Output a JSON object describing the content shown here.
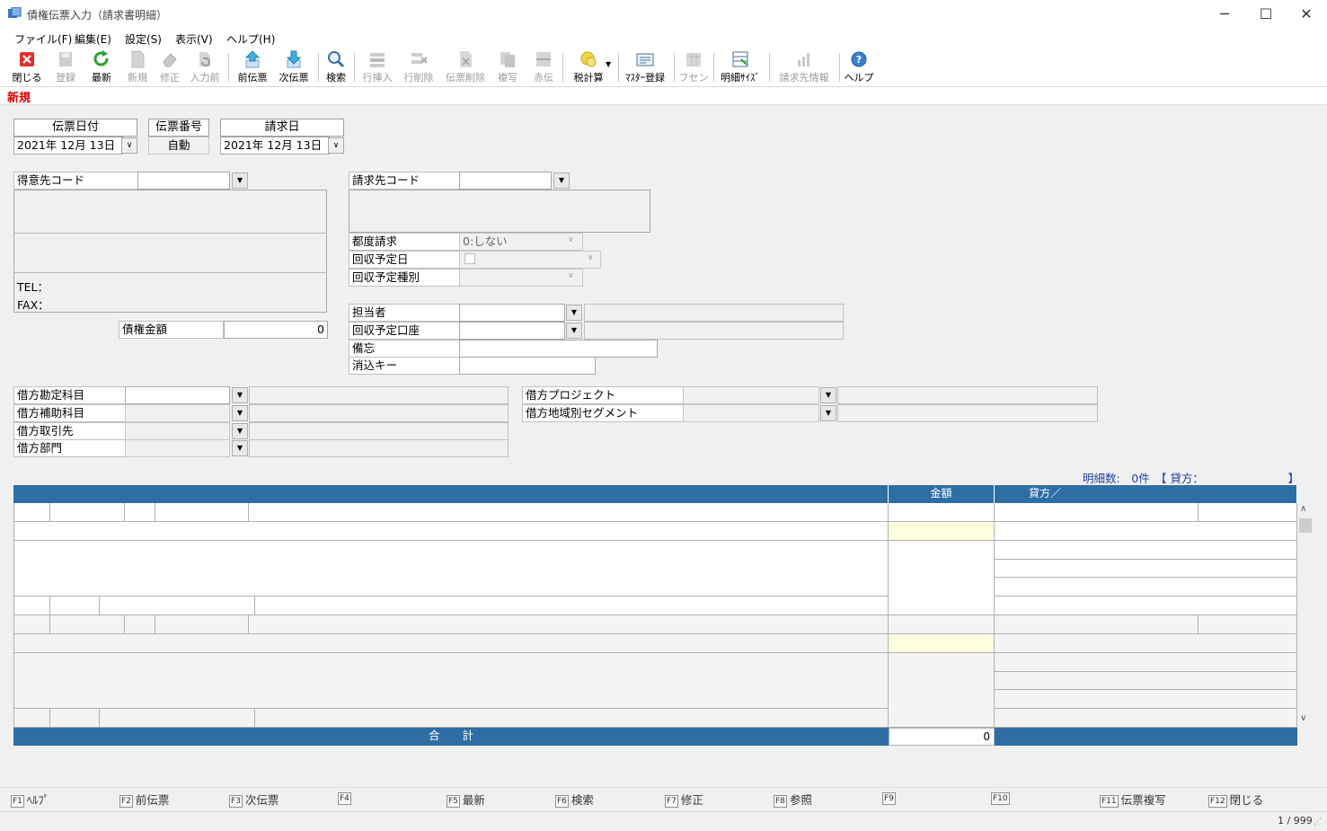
{
  "window": {
    "title": "債権伝票入力（請求書明細）",
    "minimize": "─",
    "maximize": "☐",
    "close": "✕"
  },
  "menu": [
    "ファイル(F)",
    "編集(E)",
    "設定(S)",
    "表示(V)",
    "ヘルプ(H)"
  ],
  "toolbar": [
    {
      "label": "閉じる",
      "icon": "close-icon",
      "enabled": true
    },
    {
      "label": "登録",
      "icon": "save-icon",
      "enabled": false
    },
    {
      "label": "最新",
      "icon": "refresh-icon",
      "enabled": true
    },
    {
      "label": "新規",
      "icon": "new-doc-icon",
      "enabled": false
    },
    {
      "label": "修正",
      "icon": "eraser-icon",
      "enabled": false
    },
    {
      "label": "入力前",
      "icon": "undo-icon",
      "enabled": false
    },
    {
      "label": "前伝票",
      "icon": "prev-arrow-icon",
      "enabled": true
    },
    {
      "label": "次伝票",
      "icon": "next-arrow-icon",
      "enabled": true
    },
    {
      "label": "検索",
      "icon": "search-icon",
      "enabled": true
    },
    {
      "label": "行挿入",
      "icon": "insert-row-icon",
      "enabled": false
    },
    {
      "label": "行削除",
      "icon": "delete-row-icon",
      "enabled": false
    },
    {
      "label": "伝票削除",
      "icon": "delete-doc-icon",
      "enabled": false
    },
    {
      "label": "複写",
      "icon": "copy-icon",
      "enabled": false
    },
    {
      "label": "赤伝",
      "icon": "red-slip-icon",
      "enabled": false
    },
    {
      "label": "税計算",
      "icon": "tax-calc-icon",
      "enabled": true
    },
    {
      "label": "ﾏｽﾀｰ登録",
      "icon": "master-register-icon",
      "enabled": true
    },
    {
      "label": "フセン",
      "icon": "sticky-note-icon",
      "enabled": false
    },
    {
      "label": "明細ｻｲｽﾞ",
      "icon": "detail-size-icon",
      "enabled": true
    },
    {
      "label": "請求先情報",
      "icon": "bar-chart-icon",
      "enabled": false
    },
    {
      "label": "ヘルプ",
      "icon": "help-icon",
      "enabled": true
    }
  ],
  "mode": "新規",
  "header": {
    "slip_date_label": "伝票日付",
    "slip_date_value": "2021年 12月 13日",
    "slip_no_label": "伝票番号",
    "slip_no_value": "自動",
    "billing_date_label": "請求日",
    "billing_date_value": "2021年 12月 13日"
  },
  "customer": {
    "code_label": "得意先コード",
    "tel_label": "TEL：",
    "fax_label": "FAX：",
    "amount_label": "債権金額",
    "amount_value": "0"
  },
  "billing": {
    "code_label": "請求先コード",
    "each_billing_label": "都度請求",
    "each_billing_value": "0:しない",
    "collect_date_label": "回収予定日",
    "collect_type_label": "回収予定種別",
    "staff_label": "担当者",
    "collect_account_label": "回収予定口座",
    "memo_label": "備忘",
    "clear_key_label": "消込キー"
  },
  "debit": {
    "account_label": "借方勘定科目",
    "sub_account_label": "借方補助科目",
    "partner_label": "借方取引先",
    "dept_label": "借方部門",
    "project_label": "借方プロジェクト",
    "segment_label": "借方地域別セグメント"
  },
  "summary": {
    "detail_count": "明細数:　0件　【 貸方：　　　　　　　　】"
  },
  "grid": {
    "amount_header": "金額",
    "credit_header": "貸方／",
    "total_label": "合　　計",
    "total_value": "0"
  },
  "fkeys": [
    {
      "key": "F1",
      "label": "ﾍﾙﾌﾟ"
    },
    {
      "key": "F2",
      "label": "前伝票"
    },
    {
      "key": "F3",
      "label": "次伝票"
    },
    {
      "key": "F4",
      "label": ""
    },
    {
      "key": "F5",
      "label": "最新"
    },
    {
      "key": "F6",
      "label": "検索"
    },
    {
      "key": "F7",
      "label": "修正"
    },
    {
      "key": "F8",
      "label": "参照"
    },
    {
      "key": "F9",
      "label": ""
    },
    {
      "key": "F10",
      "label": ""
    },
    {
      "key": "F11",
      "label": "伝票複写"
    },
    {
      "key": "F12",
      "label": "閉じる"
    }
  ],
  "status": {
    "page": "1 / 999"
  },
  "colors": {
    "grid_header": "#2f6ea5",
    "mode_text": "#e00000",
    "summary_text": "#1f3fa0"
  }
}
